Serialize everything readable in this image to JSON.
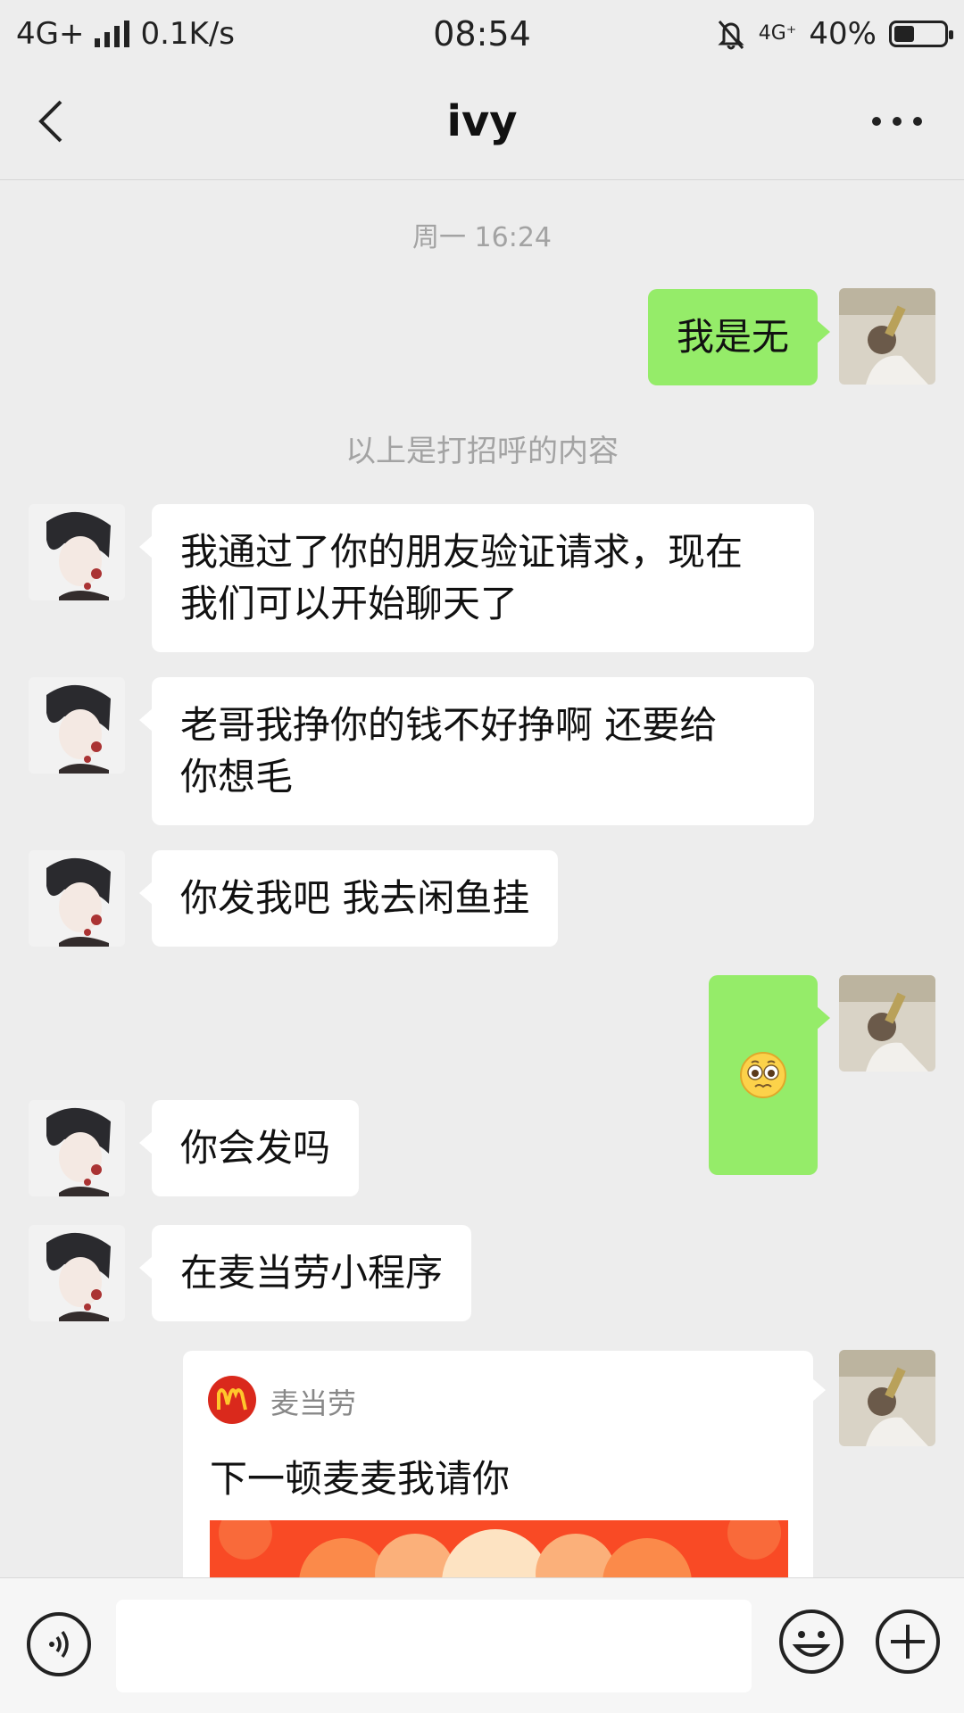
{
  "status_bar": {
    "network": "4G+",
    "speed": "0.1K/s",
    "time": "08:54",
    "network_small": "4G⁺",
    "battery": "40%",
    "battery_level": 0.4
  },
  "header": {
    "title": "ivy"
  },
  "chat": {
    "timestamp": "周一 16:24",
    "system_note": "以上是打招呼的内容",
    "messages": [
      {
        "side": "right",
        "text": "我是无"
      },
      {
        "side": "left",
        "text": "我通过了你的朋友验证请求，现在\n我们可以开始聊天了"
      },
      {
        "side": "left",
        "text": "老哥我挣你的钱不好挣啊 还要给\n你想毛"
      },
      {
        "side": "left",
        "text": "你发我吧 我去闲鱼挂"
      },
      {
        "side": "right",
        "emoji": "pleading-face-icon"
      },
      {
        "side": "left",
        "text": "你会发吗"
      },
      {
        "side": "left",
        "text": "在麦当劳小程序"
      }
    ],
    "card": {
      "brand": "麦当劳",
      "title": "下一顿麦麦我请你"
    }
  },
  "input_bar": {
    "placeholder": ""
  },
  "colors": {
    "background": "#ededed",
    "self_bubble": "#95ec69",
    "other_bubble": "#ffffff",
    "muted_text": "#a3a3a3"
  }
}
